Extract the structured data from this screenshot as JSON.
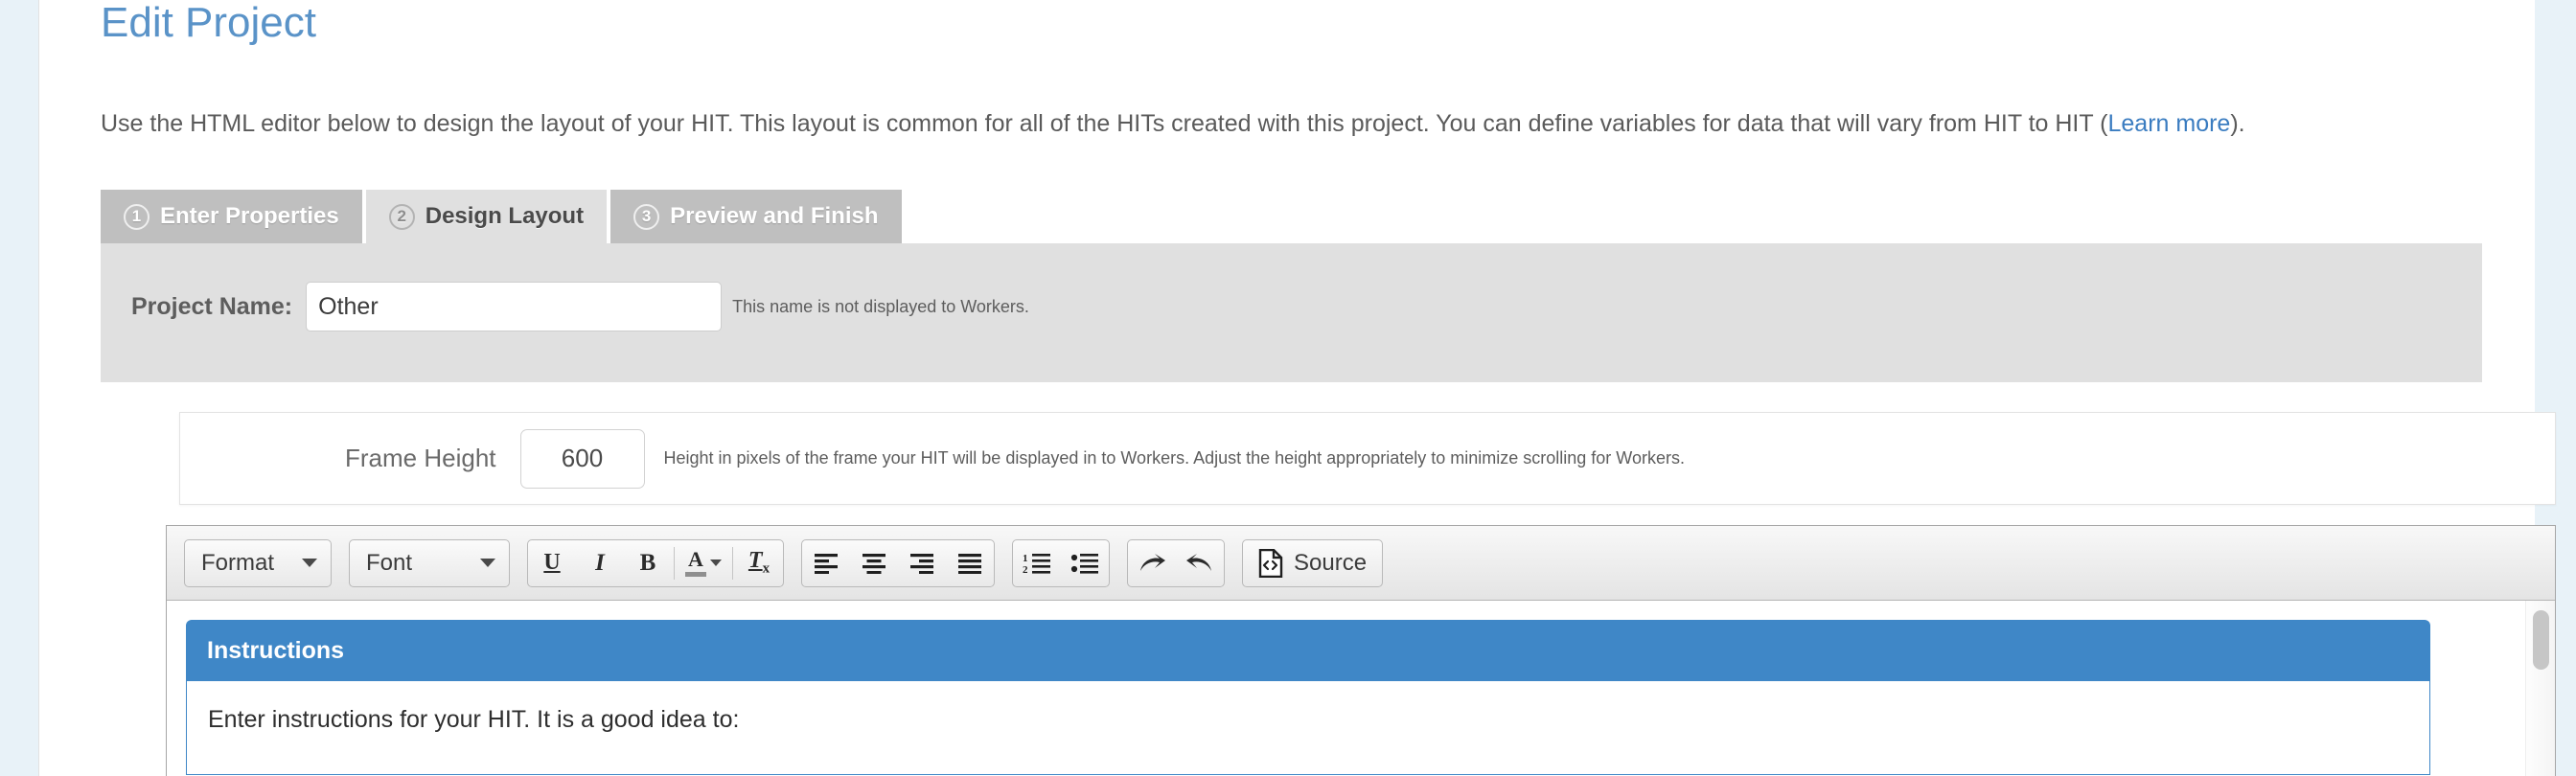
{
  "page": {
    "title": "Edit Project",
    "intro_before_link": "Use the HTML editor below to design the layout of your HIT. This layout is common for all of the HITs created with this project. You can define variables for data that will vary from HIT to HIT (",
    "intro_link": "Learn more",
    "intro_after_link": ")."
  },
  "tabs": [
    {
      "number": "1",
      "label": "Enter Properties",
      "state": "inactive"
    },
    {
      "number": "2",
      "label": "Design Layout",
      "state": "active"
    },
    {
      "number": "3",
      "label": "Preview and Finish",
      "state": "inactive"
    }
  ],
  "properties": {
    "project_name_label": "Project Name:",
    "project_name_value": "Other",
    "project_name_placeholder": "",
    "project_name_hint": "This name is not displayed to Workers."
  },
  "frame": {
    "label": "Frame Height",
    "value": "600",
    "hint": "Height in pixels of the frame your HIT will be displayed in to Workers. Adjust the height appropriately to minimize scrolling for Workers."
  },
  "toolbar": {
    "format_label": "Format",
    "font_label": "Font",
    "underline_label": "U",
    "italic_label": "I",
    "bold_label": "B",
    "text_color_label": "A",
    "remove_format_label": "T",
    "remove_format_sub": "x",
    "source_label": "Source",
    "align_left_icon": "align-left-icon",
    "align_center_icon": "align-center-icon",
    "align_right_icon": "align-right-icon",
    "align_justify_icon": "align-justify-icon",
    "numbered_list_icon": "numbered-list-icon",
    "bulleted_list_icon": "bulleted-list-icon",
    "redo_icon": "redo-arrow-icon",
    "undo_icon": "undo-arrow-icon",
    "source_icon": "source-code-file-icon"
  },
  "editor_content": {
    "instructions_heading": "Instructions",
    "instructions_text": "Enter instructions for your HIT. It is a good idea to:"
  },
  "colors": {
    "accent_blue": "#3f87c7",
    "title_blue": "#5a93c8",
    "link_blue": "#3a7cc0",
    "panel_grey": "#e0e0e0",
    "tab_inactive_grey": "#bfbfbf",
    "page_bg": "#e8f2f8"
  }
}
